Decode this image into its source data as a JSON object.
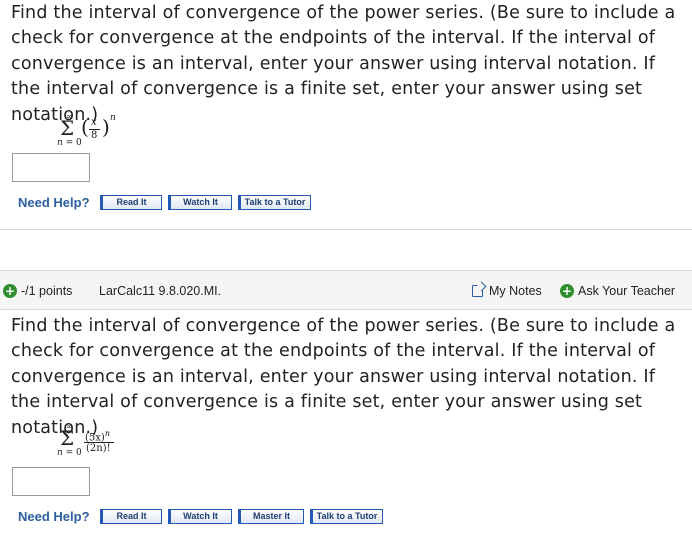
{
  "question1": {
    "text": "Find the interval of convergence of the power series. (Be sure to include a check for convergence at the endpoints of the interval. If the interval of convergence is an interval, enter your answer using interval notation. If the interval of convergence is a finite set, enter your answer using set notation.)",
    "series": {
      "sigma": "Σ",
      "upper": "∞",
      "lower_var": "n",
      "lower_eq": " = 0",
      "numerator": "x",
      "denominator": "8",
      "exponent": "n"
    },
    "answer_value": "",
    "help": {
      "label": "Need Help?",
      "buttons": [
        "Read It",
        "Watch It",
        "Talk to a Tutor"
      ]
    }
  },
  "question2": {
    "header": {
      "points": "-/1 points",
      "problem_id": "LarCalc11 9.8.020.MI.",
      "my_notes": "My Notes",
      "ask_teacher": "Ask Your Teacher"
    },
    "text": "Find the interval of convergence of the power series. (Be sure to include a check for convergence at the endpoints of the interval. If the interval of convergence is an interval, enter your answer using interval notation. If the interval of convergence is a finite set, enter your answer using set notation.)",
    "series": {
      "sigma": "Σ",
      "upper": "∞",
      "lower_var": "n",
      "lower_eq": " = 0",
      "numerator": "(5x)",
      "numerator_exp": "n",
      "denominator": "(2n)!"
    },
    "answer_value": "",
    "help": {
      "label": "Need Help?",
      "buttons": [
        "Read It",
        "Watch It",
        "Master It",
        "Talk to a Tutor"
      ]
    }
  },
  "colors": {
    "link_blue": "#2b5f9e",
    "button_border": "#2458b8",
    "plus_green": "#2f8f2f",
    "header_bg": "#f5f5f5"
  }
}
